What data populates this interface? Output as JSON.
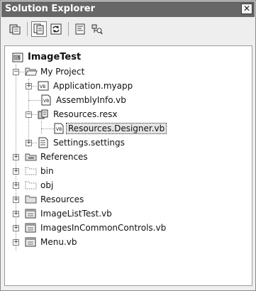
{
  "window": {
    "title": "Solution Explorer",
    "close_glyph": "✕"
  },
  "toolbar": {
    "buttons": [
      {
        "name": "properties-icon",
        "pressed": false
      },
      {
        "name": "show-all-files-icon",
        "pressed": true
      },
      {
        "name": "refresh-icon",
        "pressed": false
      },
      {
        "name": "view-code-icon",
        "pressed": false
      },
      {
        "name": "class-view-icon",
        "pressed": false
      }
    ]
  },
  "tree": {
    "root": {
      "label": "ImageTest",
      "icon": "vb-project-icon"
    },
    "items": [
      {
        "label": "My Project",
        "icon": "folder-open-icon",
        "expander": "−"
      },
      {
        "label": "Application.myapp",
        "icon": "vb-file-icon",
        "expander": "+"
      },
      {
        "label": "AssemblyInfo.vb",
        "icon": "vb-file-icon",
        "expander": ""
      },
      {
        "label": "Resources.resx",
        "icon": "resx-icon",
        "expander": "−"
      },
      {
        "label": "Resources.Designer.vb",
        "icon": "vb-file-icon",
        "expander": "",
        "selected": true
      },
      {
        "label": "Settings.settings",
        "icon": "settings-file-icon",
        "expander": "+"
      },
      {
        "label": "References",
        "icon": "references-icon",
        "expander": "+"
      },
      {
        "label": "bin",
        "icon": "folder-dotted-icon",
        "expander": "+"
      },
      {
        "label": "obj",
        "icon": "folder-dotted-icon",
        "expander": "+"
      },
      {
        "label": "Resources",
        "icon": "folder-icon",
        "expander": "+"
      },
      {
        "label": "ImageListTest.vb",
        "icon": "form-icon",
        "expander": "+"
      },
      {
        "label": "ImagesInCommonControls.vb",
        "icon": "form-icon",
        "expander": "+"
      },
      {
        "label": "Menu.vb",
        "icon": "form-icon",
        "expander": "+"
      }
    ]
  }
}
